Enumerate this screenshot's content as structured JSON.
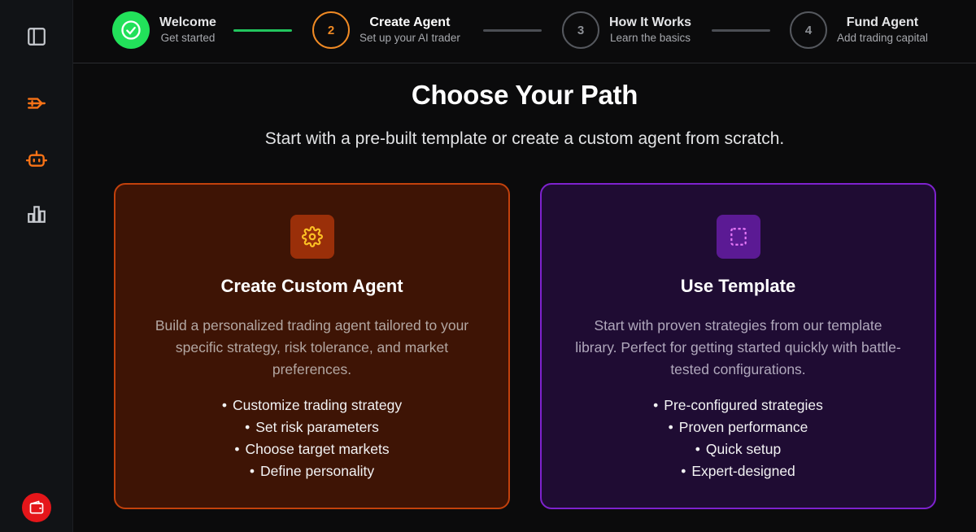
{
  "sidebar": {
    "items": [
      {
        "icon": "sidebar-toggle-icon",
        "color": "#c9ccd1"
      },
      {
        "icon": "trades-icon",
        "color": "#f97316"
      },
      {
        "icon": "robot-icon",
        "color": "#f97316"
      },
      {
        "icon": "bar-chart-icon",
        "color": "#c9ccd1"
      }
    ],
    "wallet": {
      "icon": "wallet-icon",
      "color": "#e5161a"
    }
  },
  "stepper": {
    "steps": [
      {
        "number": "",
        "title": "Welcome",
        "subtitle": "Get started",
        "state": "completed"
      },
      {
        "number": "2",
        "title": "Create Agent",
        "subtitle": "Set up your AI trader",
        "state": "active"
      },
      {
        "number": "3",
        "title": "How It Works",
        "subtitle": "Learn the basics",
        "state": "pending"
      },
      {
        "number": "4",
        "title": "Fund Agent",
        "subtitle": "Add trading capital",
        "state": "pending"
      }
    ]
  },
  "main": {
    "title": "Choose Your Path",
    "subtitle": "Start with a pre-built template or create a custom agent from scratch.",
    "cards": [
      {
        "icon": "gear-icon",
        "title": "Create Custom Agent",
        "description": "Build a personalized trading agent tailored to your specific strategy, risk tolerance, and market preferences.",
        "features": [
          "Customize trading strategy",
          "Set risk parameters",
          "Choose target markets",
          "Define personality"
        ],
        "accent": "#c2410c"
      },
      {
        "icon": "template-icon",
        "title": "Use Template",
        "description": "Start with proven strategies from our template library. Perfect for getting started quickly with battle-tested configurations.",
        "features": [
          "Pre-configured strategies",
          "Proven performance",
          "Quick setup",
          "Expert-designed"
        ],
        "accent": "#7e22ce"
      }
    ]
  },
  "colors": {
    "completed": "#22e15a",
    "active": "#f08a24",
    "pending": "#55585e"
  }
}
